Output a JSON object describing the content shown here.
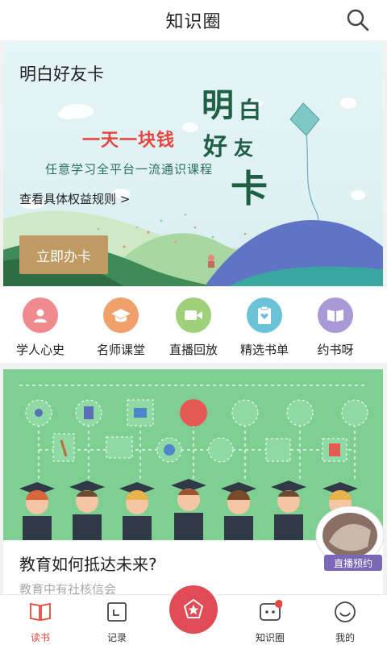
{
  "header": {
    "title": "知识圈",
    "search_icon": "search-icon"
  },
  "banner": {
    "card_title": "明白好友卡",
    "slogan": "一天一块钱",
    "subtitle": "任意学习全平台一流通识课程",
    "rules_link": "查看具体权益规则 >",
    "cta": "立即办卡",
    "calligraphy": [
      "明",
      "白",
      "好",
      "友",
      "卡"
    ]
  },
  "categories": [
    {
      "label": "学人心史",
      "icon": "person-icon",
      "color": "#f08a8e"
    },
    {
      "label": "名师课堂",
      "icon": "graduation-cap-icon",
      "color": "#f0a06a"
    },
    {
      "label": "直播回放",
      "icon": "video-camera-icon",
      "color": "#9fd07a"
    },
    {
      "label": "精选书单",
      "icon": "clipboard-heart-icon",
      "color": "#6cc3d8"
    },
    {
      "label": "约书呀",
      "icon": "open-book-icon",
      "color": "#a999d6"
    }
  ],
  "feature": {
    "title": "教育如何抵达未来?",
    "subtitle": "教育中有社核信会",
    "badge": "直播预约"
  },
  "bottom_nav": [
    {
      "label": "读书",
      "icon": "book-icon",
      "active": true
    },
    {
      "label": "记录",
      "icon": "calendar-icon",
      "active": false
    },
    {
      "label": "",
      "icon": "star-badge-icon",
      "active": false
    },
    {
      "label": "知识圈",
      "icon": "chat-bubble-icon",
      "active": false
    },
    {
      "label": "我的",
      "icon": "smiley-icon",
      "active": false
    }
  ],
  "colors": {
    "accent": "#e5473f",
    "cta": "#c09a63",
    "feature_bg": "#7fcf93",
    "live_badge": "#7a67b8"
  }
}
